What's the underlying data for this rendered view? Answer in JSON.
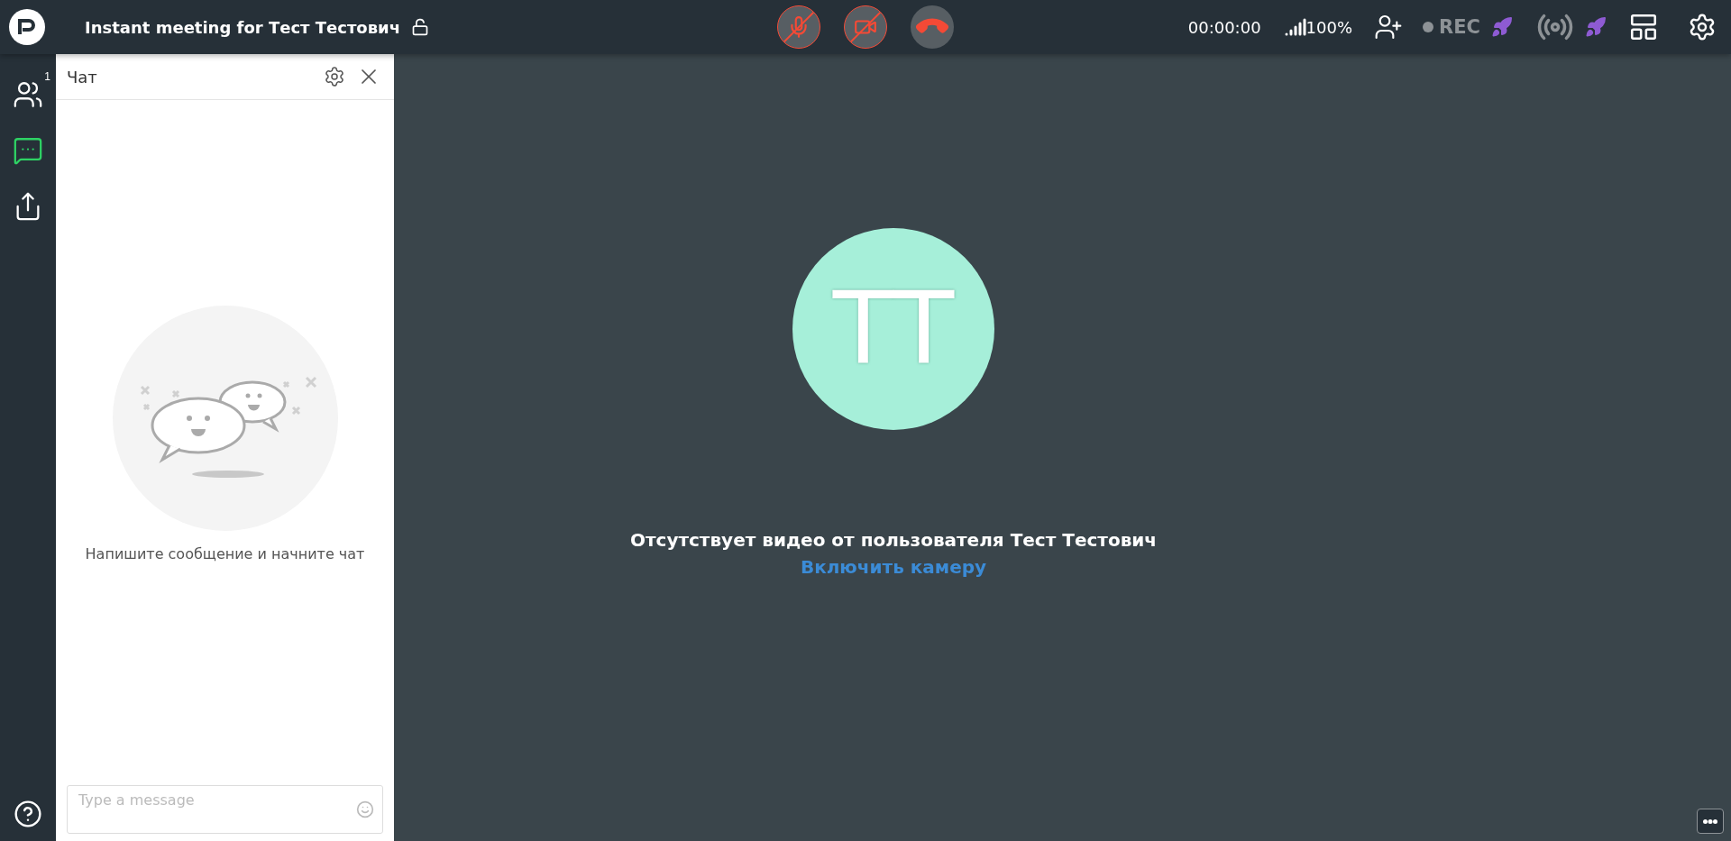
{
  "top_bar": {
    "meeting_title": "Instant meeting for Тест Тестович",
    "locked": false,
    "call_controls": [
      {
        "kind": "mic",
        "muted": true
      },
      {
        "kind": "camera",
        "muted": true
      },
      {
        "kind": "hangup",
        "muted": false
      }
    ],
    "timer": "00:00:00",
    "signal": "100%",
    "recording": {
      "label": "REC",
      "active": false
    }
  },
  "sidebar": {
    "items": [
      {
        "kind": "participants",
        "badge": "1",
        "selected": false
      },
      {
        "kind": "chat",
        "selected": true
      },
      {
        "kind": "share",
        "selected": false
      }
    ]
  },
  "chat": {
    "title": "Чат",
    "empty_text": "Напишите сообщение и начните чат",
    "input": {
      "placeholder": "Type a message"
    }
  },
  "stage": {
    "avatar_initials": "ТТ",
    "message": "Отсутствует видео от пользователя Тест Тестович",
    "link": "Включить камеру"
  }
}
